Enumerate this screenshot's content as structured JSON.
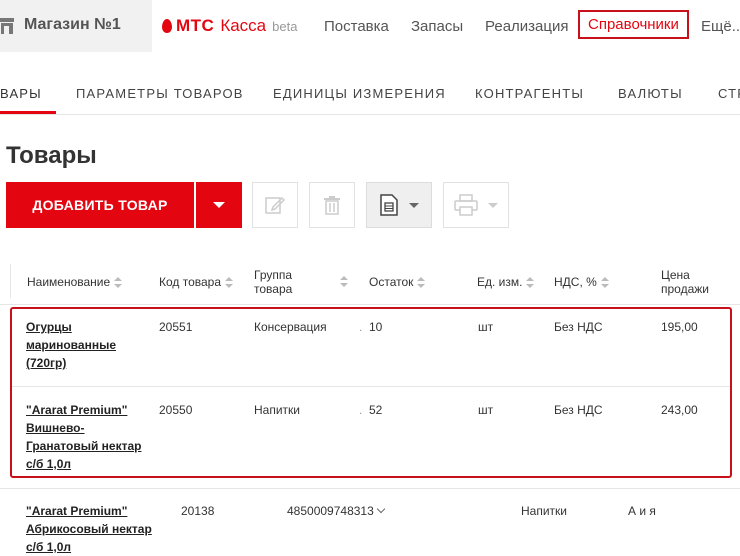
{
  "header": {
    "store_name": "Магазин №1",
    "logo_mts": "МТС",
    "logo_kassa": "Касса",
    "logo_beta": "beta",
    "nav": [
      "Поставка",
      "Запасы",
      "Реализация",
      "Справочники",
      "Ещё..."
    ],
    "active_nav": "Справочники",
    "accent_color": "#e30611"
  },
  "tabs": [
    "ВАРЫ",
    "ПАРАМЕТРЫ ТОВАРОВ",
    "ЕДИНИЦЫ ИЗМЕРЕНИЯ",
    "КОНТРАГЕНТЫ",
    "ВАЛЮТЫ",
    "СТР"
  ],
  "page": {
    "title": "Товары",
    "add_button": "ДОБАВИТЬ ТОВАР"
  },
  "table": {
    "headers": {
      "name": "Наименование",
      "code": "Код товара",
      "group_line1": "Группа",
      "group_line2": "товара",
      "stock": "Остаток",
      "unit": "Ед. изм.",
      "vat": "НДС, %",
      "price_line1": "Цена",
      "price_line2": "продажи"
    },
    "rows": [
      {
        "name_lines": [
          "Огурцы",
          "маринованные",
          "(720гр)"
        ],
        "code": "20551",
        "group": "Консервация",
        "stock": "10",
        "unit": "шт",
        "vat": "Без НДС",
        "price": "195,00"
      },
      {
        "name_lines": [
          "\"Ararat Premium\"",
          "Вишнево-",
          "Гранатовый нектар",
          "с/б 1,0л"
        ],
        "code": "20550",
        "group": "Напитки",
        "stock": "52",
        "unit": "шт",
        "vat": "Без НДС",
        "price": "243,00"
      },
      {
        "name_lines": [
          "\"Ararat Premium\"",
          "Абрикосовый нектар",
          "с/б 1,0л"
        ],
        "code": "20138",
        "barcode": "4850009748313",
        "group": "Напитки",
        "unit": "А и я"
      }
    ]
  },
  "icons": [
    "store-icon",
    "edit-icon",
    "trash-icon",
    "document-icon",
    "print-icon",
    "chevron-down-icon"
  ]
}
